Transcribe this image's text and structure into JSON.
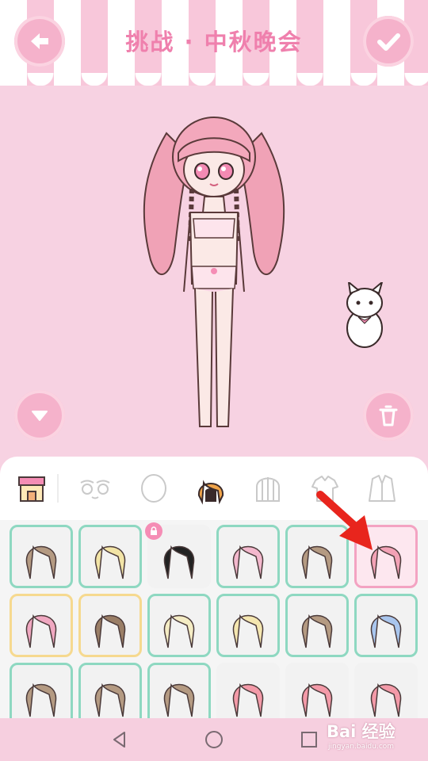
{
  "header": {
    "title": "挑战 · 中秋晚会",
    "back_icon": "arrow-left-icon",
    "confirm_icon": "check-icon"
  },
  "stage": {
    "character": "pink-twintail-girl",
    "pet": "white-cat-with-bow",
    "collapse_icon": "triangle-down-icon",
    "trash_icon": "trash-icon"
  },
  "category_tabs": [
    {
      "name": "shop",
      "icon": "shop-icon"
    },
    {
      "name": "eyes",
      "icon": "eyes-icon"
    },
    {
      "name": "face",
      "icon": "face-icon"
    },
    {
      "name": "hair",
      "icon": "hair-icon",
      "selected": true
    },
    {
      "name": "back-hair",
      "icon": "back-hair-icon"
    },
    {
      "name": "top",
      "icon": "shirt-icon"
    },
    {
      "name": "jacket",
      "icon": "jacket-icon"
    }
  ],
  "hair_items": [
    {
      "hair_color": "#b49a82",
      "border": "green"
    },
    {
      "hair_color": "#f2e4a6",
      "border": "green"
    },
    {
      "hair_color": "#222222",
      "border": "none",
      "locked": true
    },
    {
      "hair_color": "#f3b8cd",
      "border": "green"
    },
    {
      "hair_color": "#b49a82",
      "border": "green"
    },
    {
      "hair_color": "#f3a2b6",
      "border": "pink",
      "selected": true
    },
    {
      "hair_color": "#f0a8c1",
      "border": "yellow"
    },
    {
      "hair_color": "#9a7e66",
      "border": "yellow"
    },
    {
      "hair_color": "#f4ecc4",
      "border": "green"
    },
    {
      "hair_color": "#f4e6b0",
      "border": "green"
    },
    {
      "hair_color": "#b49a82",
      "border": "green"
    },
    {
      "hair_color": "#a9c6ee",
      "border": "green"
    },
    {
      "hair_color": "#b49a82",
      "border": "green"
    },
    {
      "hair_color": "#b49a82",
      "border": "green"
    },
    {
      "hair_color": "#b49a82",
      "border": "green"
    },
    {
      "hair_color": "#f39aa8",
      "border": "none"
    },
    {
      "hair_color": "#f39aa8",
      "border": "none"
    },
    {
      "hair_color": "#f39aa8",
      "border": "none"
    }
  ],
  "annotation": {
    "type": "red-arrow",
    "target": "selected hair item"
  },
  "navbar": {
    "back_icon": "nav-back-icon",
    "home_icon": "nav-home-icon",
    "recents_icon": "nav-recents-icon"
  },
  "watermark": {
    "brand": "Bai 经验",
    "url": "jingyan.baidu.com"
  },
  "colors": {
    "background": "#f7d2e2",
    "accent": "#ef80ad",
    "button": "#f5b2cb",
    "selected_border": "#f3a3c2",
    "green_border": "#8ed8c1",
    "yellow_border": "#f6d98f"
  }
}
